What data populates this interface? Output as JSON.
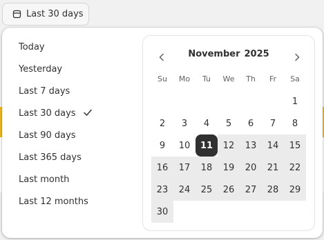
{
  "trigger": {
    "label": "Last 30 days",
    "icon": "calendar-icon"
  },
  "presets": [
    {
      "label": "Today",
      "selected": false
    },
    {
      "label": "Yesterday",
      "selected": false
    },
    {
      "label": "Last 7 days",
      "selected": false
    },
    {
      "label": "Last 30 days",
      "selected": true
    },
    {
      "label": "Last 90 days",
      "selected": false
    },
    {
      "label": "Last 365 days",
      "selected": false
    },
    {
      "label": "Last month",
      "selected": false
    },
    {
      "label": "Last 12 months",
      "selected": false
    }
  ],
  "calendar": {
    "month": "November",
    "year": "2025",
    "weekdays": [
      "Su",
      "Mo",
      "Tu",
      "We",
      "Th",
      "Fr",
      "Sa"
    ],
    "weeks": [
      [
        "",
        "",
        "",
        "",
        "",
        "",
        "1"
      ],
      [
        "2",
        "3",
        "4",
        "5",
        "6",
        "7",
        "8"
      ],
      [
        "9",
        "10",
        "11",
        "12",
        "13",
        "14",
        "15"
      ],
      [
        "16",
        "17",
        "18",
        "19",
        "20",
        "21",
        "22"
      ],
      [
        "23",
        "24",
        "25",
        "26",
        "27",
        "28",
        "29"
      ],
      [
        "30",
        "",
        "",
        "",
        "",
        "",
        ""
      ]
    ],
    "selected_day": "11",
    "range_start_day": 11,
    "range_end_day": 30
  },
  "colors": {
    "selected_bg": "#303030",
    "range_bg": "#ebebeb",
    "backdrop_accent": "#f1b721"
  }
}
